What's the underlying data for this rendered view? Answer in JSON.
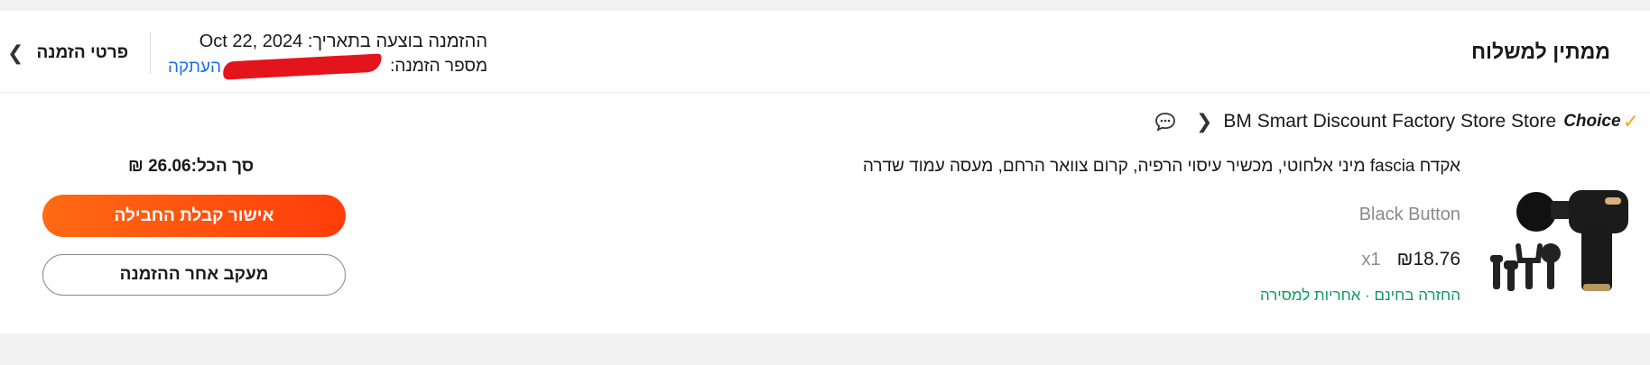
{
  "header": {
    "status": "ממתין למשלוח",
    "order_date_label": "ההזמנה בוצעה בתאריך:",
    "order_date": "Oct 22, 2024",
    "order_number_label": "מספר הזמנה:",
    "copy_label": "העתקה",
    "details_label": "פרטי הזמנה"
  },
  "store": {
    "choice_label": "Choice",
    "name": "BM Smart Discount Factory Store Store"
  },
  "product": {
    "title": "אקדח fascia מיני אלחוטי, מכשיר עיסוי הרפיה, קרום צוואר הרחם, מעסה עמוד שדרה",
    "variant": "Black Button",
    "price": "₪18.76",
    "quantity": "x1",
    "benefits": "החזרה בחינם · אחריות למסירה"
  },
  "summary": {
    "total": "סך הכל:26.06 ₪",
    "confirm_label": "אישור קבלת החבילה",
    "track_label": "מעקב אחר ההזמנה"
  },
  "colors": {
    "accent": "#ff4f0f",
    "link": "#1a6fe8",
    "benefit": "#0a9b5c",
    "choice_check": "#f5a623"
  }
}
